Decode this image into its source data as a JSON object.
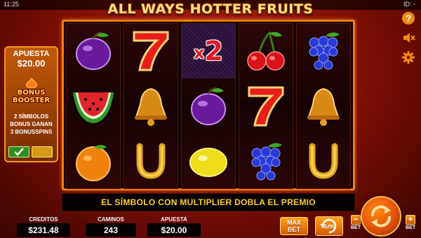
{
  "status_bar": {
    "time": "11:25",
    "id_label": "ID: -"
  },
  "game_title": "ALL WAYS HOTTER FRUITS",
  "bonus_panel": {
    "label": "APUESTA",
    "amount": "$20.00",
    "booster_line1": "BONUS",
    "booster_line2": "BOOSTER",
    "desc_line1": "2 SÍMBOLOS",
    "desc_line2": "BONUS GANAN",
    "desc_line3": "3 BONUSSPINS",
    "toggle_state": "on"
  },
  "reels": [
    [
      "plum",
      "watermelon",
      "orange"
    ],
    [
      "seven",
      "bell",
      "horseshoe"
    ],
    [
      "multiplier",
      "plum",
      "lemon"
    ],
    [
      "cherry",
      "seven",
      "grapes"
    ],
    [
      "grapes",
      "bell",
      "horseshoe"
    ]
  ],
  "multiplier": {
    "x": "x",
    "value": "2"
  },
  "side_buttons": {
    "help_icon": "question-icon",
    "sound_icon": "speaker-mute-icon",
    "settings_icon": "gear-icon"
  },
  "message": "EL SÍMBOLO CON MULTIPLIER DOBLA EL PREMIO",
  "stats": {
    "credits_label": "CREDITOS",
    "credits_value": "$231.48",
    "ways_label": "CAMINOS",
    "ways_value": "243",
    "bet_label": "APUESTA",
    "bet_value": "$20.00"
  },
  "controls": {
    "maxbet_line1": "MAX",
    "maxbet_line2": "BET",
    "auto_label": "AUTO",
    "bet_minus_symbol": "−",
    "bet_plus_symbol": "+",
    "bet_word": "BET"
  },
  "colors": {
    "frame": "#f07c12",
    "message_text": "#ffcf2e",
    "title": "#ffe27a"
  }
}
